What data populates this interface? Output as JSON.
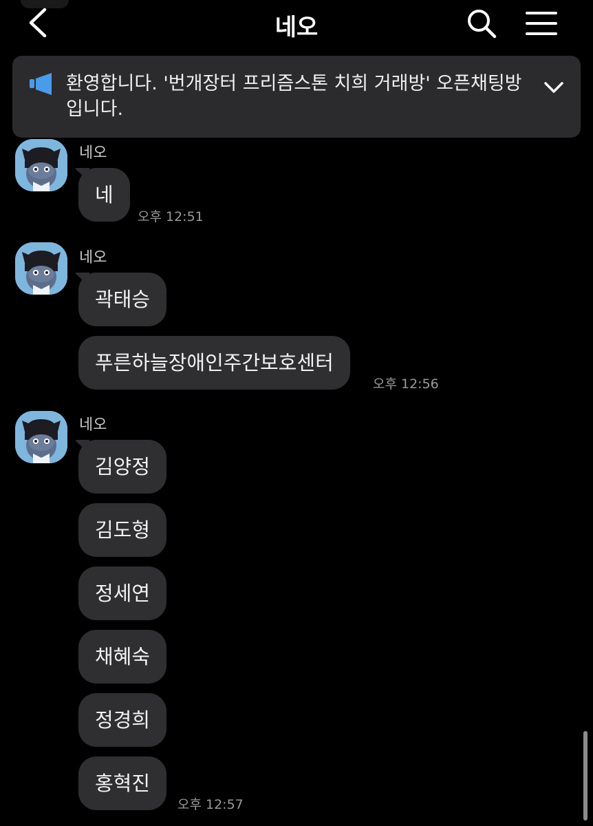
{
  "header": {
    "title": "네오",
    "back_icon": "chevron-left-icon",
    "search_icon": "search-icon",
    "menu_icon": "hamburger-menu-icon"
  },
  "notice": {
    "icon": "megaphone-icon",
    "text": "환영합니다. '번개장터 프리즘스톤 치희 거래방' 오픈채팅방입니다.",
    "toggle_icon": "chevron-down-icon"
  },
  "groups": [
    {
      "sender": "네오",
      "messages": [
        "네"
      ],
      "time": "오후 12:51"
    },
    {
      "sender": "네오",
      "messages": [
        "곽태승",
        "푸른하늘장애인주간보호센터"
      ],
      "time": "오후 12:56"
    },
    {
      "sender": "네오",
      "messages": [
        "김양정",
        "김도형",
        "정세연",
        "채혜숙",
        "정경희",
        "홍혁진"
      ],
      "time": "오후 12:57"
    }
  ],
  "colors": {
    "background": "#000000",
    "bubble": "#2f2f31",
    "notice": "#2b2b2d",
    "accent": "#4a9bea",
    "avatar": "#7fb6de"
  }
}
